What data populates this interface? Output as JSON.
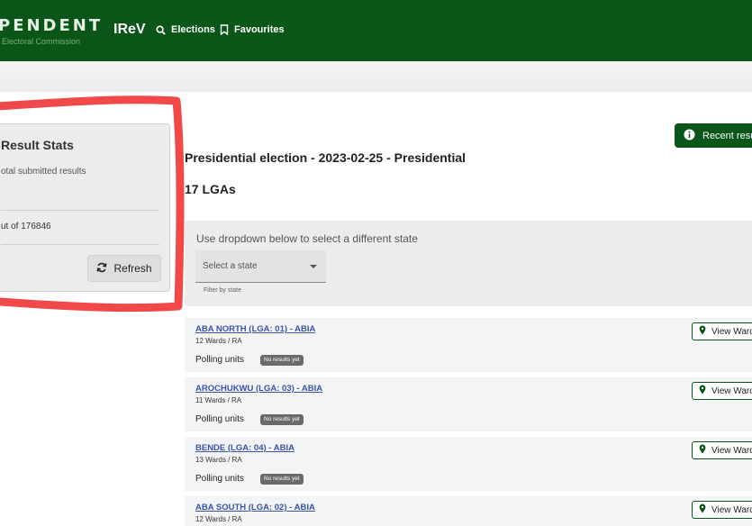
{
  "header": {
    "brand_title": "PENDENT",
    "brand_subtitle": "Electoral Commission",
    "app_name": "IReV",
    "nav": [
      {
        "label": "Elections",
        "icon": "search-icon"
      },
      {
        "label": "Favourites",
        "icon": "bookmark-icon"
      }
    ]
  },
  "stats": {
    "title": "Result Stats",
    "subtitle": "otal submitted results",
    "out_of": "ut of 176846",
    "refresh_label": "Refresh"
  },
  "recent_results_label": "Recent resu",
  "election_title": "Presidential election - 2023-02-25 - Presidential",
  "lga_count": "17 LGAs",
  "state_selector": {
    "hint": "Use dropdown below to select a different state",
    "placeholder": "Select a state",
    "filter_label": "Filter by state"
  },
  "lgas": [
    {
      "name": "ABA NORTH (LGA: 01) - ABIA",
      "wards": "12 Wards / RA",
      "pu_label": "Polling units",
      "status": "No results yet",
      "view_label": "View Ward"
    },
    {
      "name": "AROCHUKWU (LGA: 03) - ABIA",
      "wards": "11 Wards / RA",
      "pu_label": "Polling units",
      "status": "No results yet",
      "view_label": "View Ward"
    },
    {
      "name": "BENDE (LGA: 04) - ABIA",
      "wards": "13 Wards / RA",
      "pu_label": "Polling units",
      "status": "No results yet",
      "view_label": "View Ward"
    },
    {
      "name": "ABA SOUTH (LGA: 02) - ABIA",
      "wards": "12 Wards / RA",
      "pu_label": "Polling units",
      "status": "No results yet",
      "view_label": "View Ward"
    }
  ],
  "colors": {
    "brand_green": "#0a5518",
    "highlight_red": "#f03a3a",
    "link_blue": "#3a53a4"
  }
}
